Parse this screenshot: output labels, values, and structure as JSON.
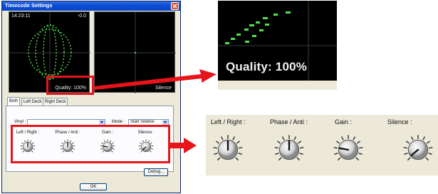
{
  "window": {
    "title": "Timecode Settings",
    "close_glyph": "close-icon"
  },
  "left_scope": {
    "time": "14:23:11",
    "offset": "-0.0",
    "quality": "Quality: 100%"
  },
  "right_scope": {
    "status": "Silence"
  },
  "tabs": [
    {
      "label": "Both",
      "active": true
    },
    {
      "label": "Left Deck",
      "active": false
    },
    {
      "label": "Right Deck",
      "active": false
    }
  ],
  "fields": {
    "vinyl_label": "Vinyl :",
    "vinyl_value": "",
    "mode_label": "Mode :",
    "mode_value": "Start relative"
  },
  "knobs": [
    {
      "label": "Left / Right :",
      "value_deg": 0
    },
    {
      "label": "Phase / Anti :",
      "value_deg": 0
    },
    {
      "label": "Gain :",
      "value_deg": -80
    },
    {
      "label": "Silence :",
      "value_deg": -130
    }
  ],
  "buttons": {
    "debug": "Debug...",
    "ok": "OK"
  },
  "zoom": {
    "quality": "Quality: 100%"
  },
  "colors": {
    "highlight": "#e8141b",
    "scope_green": "#4de34d",
    "titlebar": "#0a4fd6"
  }
}
